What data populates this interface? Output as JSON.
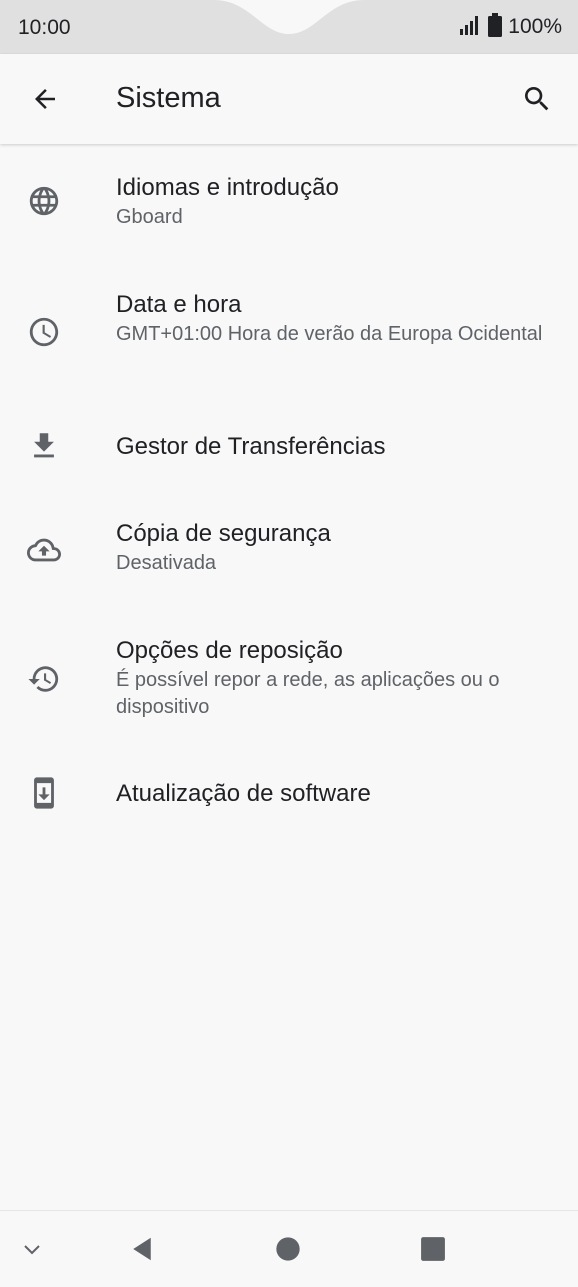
{
  "status_bar": {
    "time": "10:00",
    "battery": "100%",
    "signal_icon": "cell-signal-icon",
    "battery_icon": "battery-full-icon"
  },
  "app_bar": {
    "title": "Sistema",
    "back_icon": "arrow-back-icon",
    "search_icon": "search-icon"
  },
  "items": [
    {
      "icon": "globe-icon",
      "title": "Idiomas e introdução",
      "subtitle": "Gboard"
    },
    {
      "icon": "clock-icon",
      "title": "Data e hora",
      "subtitle": "GMT+01:00 Hora de verão da Europa Ocidental"
    },
    {
      "icon": "download-icon",
      "title": "Gestor de Transferências",
      "subtitle": ""
    },
    {
      "icon": "cloud-upload-icon",
      "title": "Cópia de segurança",
      "subtitle": "Desativada"
    },
    {
      "icon": "history-icon",
      "title": "Opções de reposição",
      "subtitle": "É possível repor a rede, as aplicações ou o dispositivo"
    },
    {
      "icon": "system-update-icon",
      "title": "Atualização de software",
      "subtitle": ""
    }
  ],
  "nav_bar": {
    "collapse_icon": "chevron-down-icon",
    "back_icon": "nav-back-icon",
    "home_icon": "nav-home-icon",
    "recents_icon": "nav-recents-icon"
  },
  "colors": {
    "background": "#f8f8f8",
    "status_bar": "#e0e0e0",
    "text_primary": "#202124",
    "text_secondary": "#5f6368",
    "icon": "#5f6368"
  }
}
